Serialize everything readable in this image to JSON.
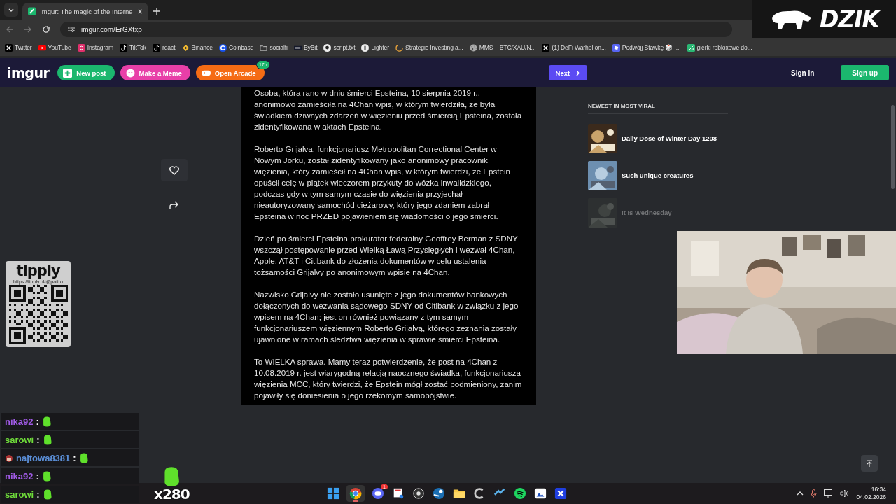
{
  "browser": {
    "tab": {
      "title": "Imgur: The magic of the Interne",
      "selected": true
    },
    "address": "imgur.com/ErGXtxp",
    "bookmarks": [
      {
        "label": "Twitter",
        "kind": "x"
      },
      {
        "label": "YouTube",
        "kind": "youtube"
      },
      {
        "label": "Instagram",
        "kind": "instagram"
      },
      {
        "label": "TikTok",
        "kind": "tiktok"
      },
      {
        "label": "react",
        "kind": "tiktok"
      },
      {
        "label": "Binance",
        "kind": "binance"
      },
      {
        "label": "Coinbase",
        "kind": "coinbase"
      },
      {
        "label": "socialfi",
        "kind": "folder"
      },
      {
        "label": "ByBit",
        "kind": "bybit"
      },
      {
        "label": "script.txt",
        "kind": "github"
      },
      {
        "label": "Lighter",
        "kind": "lighter"
      },
      {
        "label": "Strategic Investing a...",
        "kind": "spinner"
      },
      {
        "label": "MMS – BTC/XAU/N...",
        "kind": "globe"
      },
      {
        "label": "(1) DeFi Warhol on...",
        "kind": "x"
      },
      {
        "label": "Podwójj Stawkę 🎲 |...",
        "kind": "roblox"
      },
      {
        "label": "gierki robloxowe do...",
        "kind": "game"
      }
    ]
  },
  "imgur_header": {
    "logo": "imgur",
    "buttons": [
      {
        "label": "New post",
        "color": "#1bb76e",
        "kind": "plus"
      },
      {
        "label": "Make a Meme",
        "color": "#e83fa8",
        "kind": "meme"
      },
      {
        "label": "Open Arcade",
        "color": "#f56b14",
        "kind": "arcade",
        "badge": "17h"
      }
    ],
    "next": "Next",
    "sign_in": "Sign in",
    "sign_up": "Sign up"
  },
  "post": {
    "paragraphs": [
      "Osoba, która rano w dniu śmierci Epsteina, 10 sierpnia 2019 r., anonimowo zamieściła na 4Chan wpis, w którym twierdziła, że była świadkiem dziwnych zdarzeń w więzieniu przed śmiercią Epsteina, została zidentyfikowana w aktach Epsteina.",
      "Roberto Grijalva, funkcjonariusz Metropolitan Correctional Center w Nowym Jorku, został zidentyfikowany jako anonimowy pracownik więzienia, który zamieścił na 4Chan wpis, w którym twierdzi, że Epstein opuścił celę w piątek wieczorem przykuty do wózka inwalidzkiego, podczas gdy w tym samym czasie do więzienia przyjechał nieautoryzowany samochód ciężarowy, który jego zdaniem zabrał Epsteina w noc PRZED pojawieniem się wiadomości o jego śmierci.",
      "Dzień po śmierci Epsteina prokurator federalny Geoffrey Berman z SDNY wszczął postępowanie przed Wielką Ławą Przysięgłych i wezwał 4Chan, Apple, AT&T i Citibank do złożenia dokumentów w celu ustalenia tożsamości Grijalvy po anonimowym wpisie na 4Chan.",
      "Nazwisko Grijalvy nie zostało usunięte z jego dokumentów bankowych dołączonych do wezwania sądowego SDNY od Citibank w związku z jego wpisem na 4Chan; jest on również powiązany z tym samym funkcjonariuszem więziennym Roberto Grijalvą, którego zeznania zostały ujawnione w ramach śledztwa więzienia w sprawie śmierci Epsteina.",
      "To WIELKA sprawa. Mamy teraz potwierdzenie, że post na 4Chan z 10.08.2019 r. jest wiarygodną relacją naocznego świadka, funkcjonariusza więzienia MCC, który twierdzi, że Epstein mógł zostać podmieniony, zanim pojawiły się doniesienia o jego rzekomym samobójstwie."
    ]
  },
  "sidebar": {
    "heading": "NEWEST IN MOST VIRAL",
    "items": [
      {
        "title": "Daily Dose of Winter Day 1208",
        "dimmed": false
      },
      {
        "title": "Such unique creatures",
        "dimmed": false
      },
      {
        "title": "It Is Wednesday",
        "dimmed": true
      }
    ]
  },
  "overlays": {
    "brand": "DZIK",
    "tipply": {
      "title": "tipply",
      "url": "https://tipply.pl/@patiro"
    },
    "chat": [
      {
        "user": "nika92",
        "color": "#a15be6",
        "separator": ":",
        "badge": false
      },
      {
        "user": "sarowi",
        "color": "#6fdc3a",
        "separator": ":",
        "badge": false
      },
      {
        "user": "najtowa8381",
        "color": "#5b8fd8",
        "separator": ":",
        "badge": true
      },
      {
        "user": "nika92",
        "color": "#a15be6",
        "separator": ":",
        "badge": false
      },
      {
        "user": "sarowi",
        "color": "#6fdc3a",
        "separator": ":",
        "badge": false
      }
    ],
    "emote_counter": "x280"
  },
  "taskbar": {
    "apps": [
      {
        "kind": "windows",
        "active": false
      },
      {
        "kind": "chrome",
        "active": true
      },
      {
        "kind": "discord",
        "active": false,
        "badge": "1"
      },
      {
        "kind": "snip",
        "active": false
      },
      {
        "kind": "obs",
        "active": false
      },
      {
        "kind": "steam",
        "active": false
      },
      {
        "kind": "folder",
        "active": false
      },
      {
        "kind": "ccleaner",
        "active": false
      },
      {
        "kind": "tool",
        "active": false
      },
      {
        "kind": "spotify",
        "active": false
      },
      {
        "kind": "photos",
        "active": false
      },
      {
        "kind": "capcut",
        "active": false
      }
    ],
    "time": "16:34",
    "date": "04.02.2026"
  }
}
